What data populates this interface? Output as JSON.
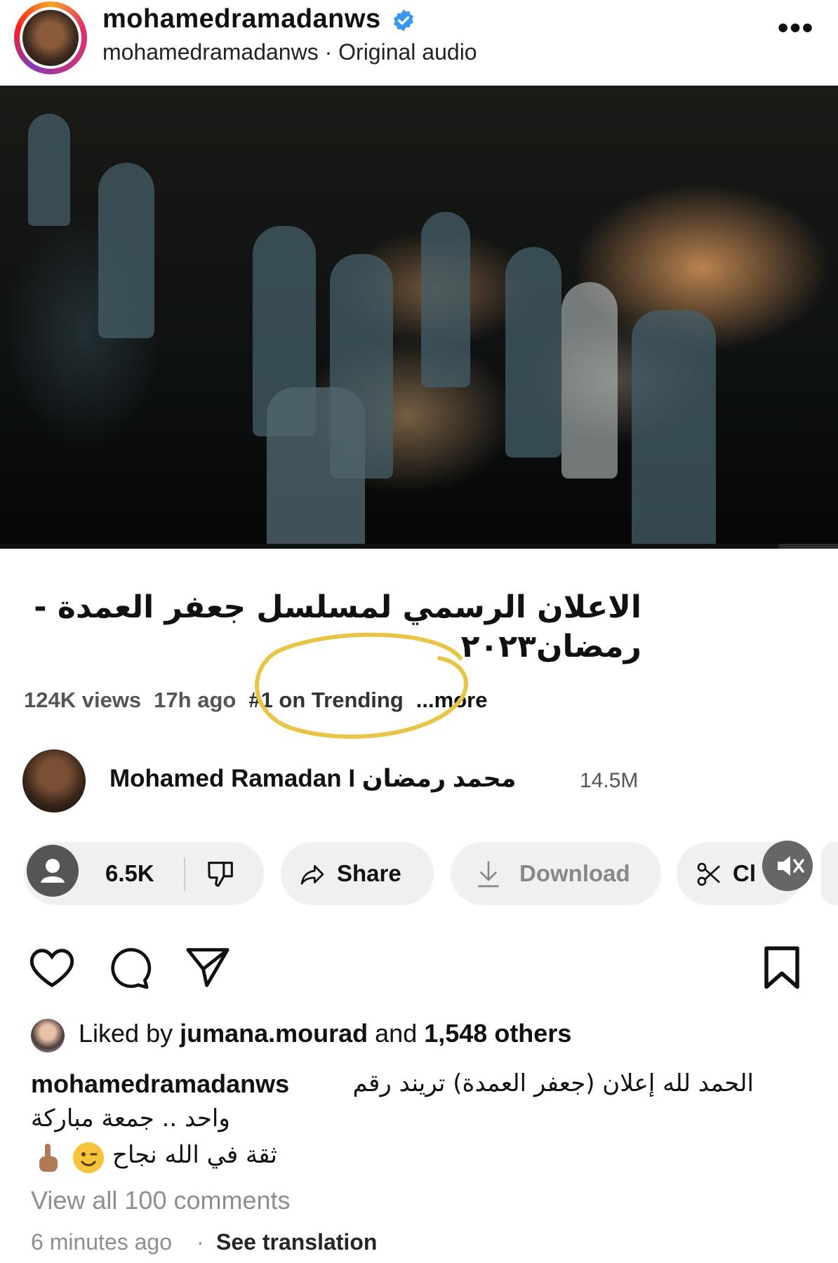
{
  "header": {
    "username": "mohamedramadanws",
    "subtitle": "mohamedramadanws · Original audio",
    "more_label": "•••"
  },
  "video": {
    "title": "الاعلان الرسمي لمسلسل جعفر العمدة - رمضان٢٠٢٣",
    "progress": 0.93
  },
  "meta": {
    "views": "124K views",
    "age": "17h ago",
    "trending": "#1 on Trending",
    "more": "...more"
  },
  "channel": {
    "name": "Mohamed Ramadan I محمد رمضان",
    "subscribers": "14.5M"
  },
  "actions": {
    "likes": "6.5K",
    "share": "Share",
    "download": "Download",
    "clip": "Cl"
  },
  "post": {
    "liked_prefix": "Liked by ",
    "liked_user": "jumana.mourad",
    "liked_mid": " and ",
    "liked_others": "1,548 others",
    "caption_user": "mohamedramadanws",
    "caption_line1": "الحمد لله إعلان (جعفر العمدة) تريند رقم",
    "caption_line2": "واحد .. جمعة مباركة",
    "caption_line3": "ثقة في الله نجاح",
    "view_comments": "View all 100 comments",
    "time_ago": "6 minutes ago",
    "separator": "·",
    "see_translation": "See translation"
  },
  "colors": {
    "verified": "#3897f0",
    "trend_circle": "#e8c547",
    "pill_bg": "#f0f0f0"
  }
}
